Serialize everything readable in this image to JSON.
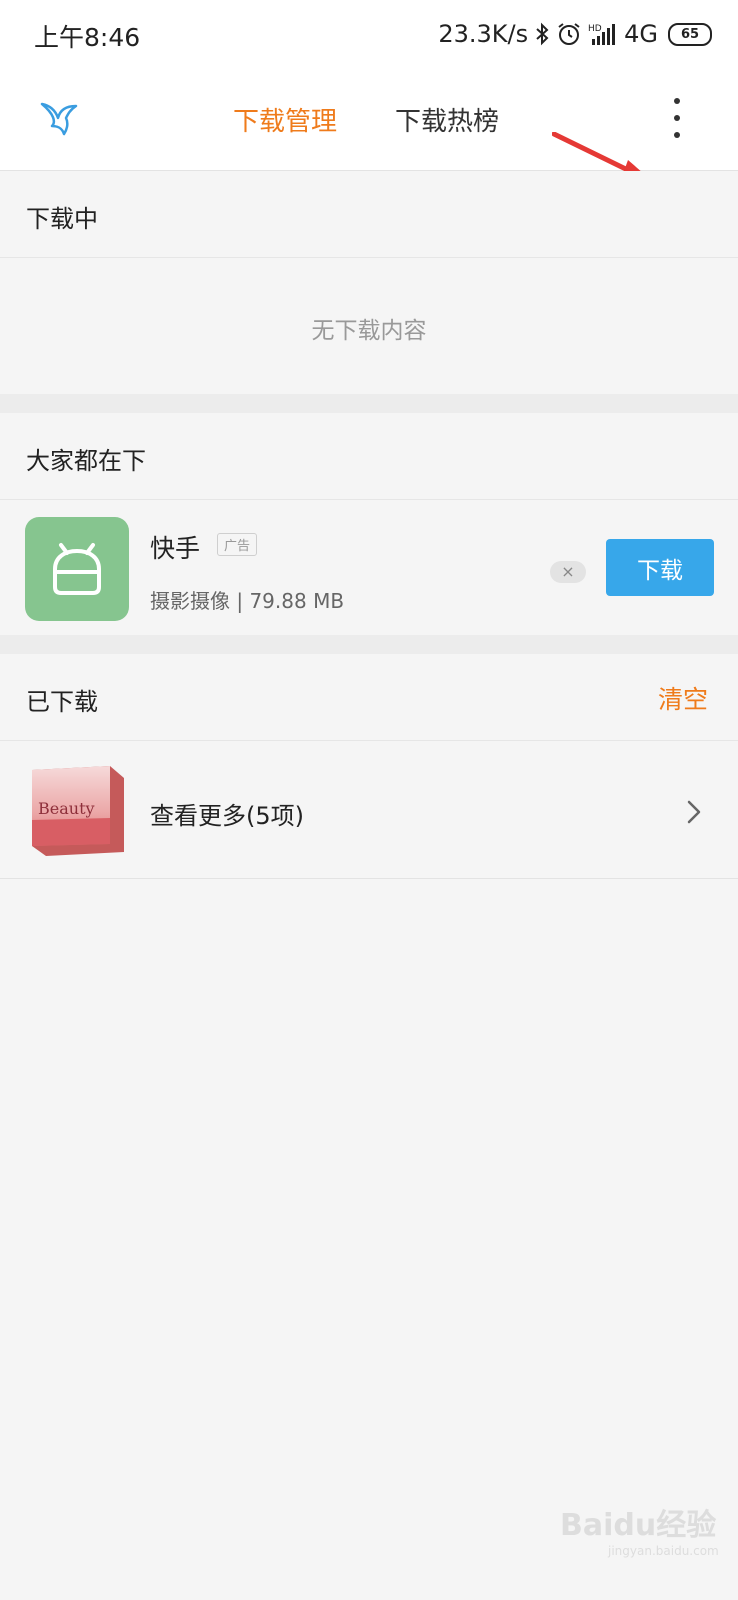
{
  "status_bar": {
    "time": "上午8:46",
    "network_speed": "23.3K/s",
    "network_type": "4G",
    "battery": "65",
    "icons": [
      "bluetooth-icon",
      "alarm-icon",
      "hd-signal-icon",
      "battery-icon"
    ]
  },
  "appbar": {
    "tabs": [
      {
        "label": "下载管理",
        "active": true
      },
      {
        "label": "下载热榜",
        "active": false
      }
    ],
    "accent_color": "#ef7b1b"
  },
  "sections": {
    "downloading": {
      "title": "下载中",
      "empty_text": "无下载内容"
    },
    "popular": {
      "title": "大家都在下",
      "app": {
        "name": "快手",
        "ad_tag": "广告",
        "category": "摄影摄像",
        "size": "79.88 MB",
        "download_label": "下载",
        "dismiss_label": "×"
      }
    },
    "downloaded": {
      "title": "已下载",
      "clear_label": "清空",
      "more_label": "查看更多(5项)",
      "thumbnail_text": "Beauty"
    }
  },
  "watermark": {
    "text": "Baidu经验",
    "sub": "jingyan.baidu.com"
  }
}
